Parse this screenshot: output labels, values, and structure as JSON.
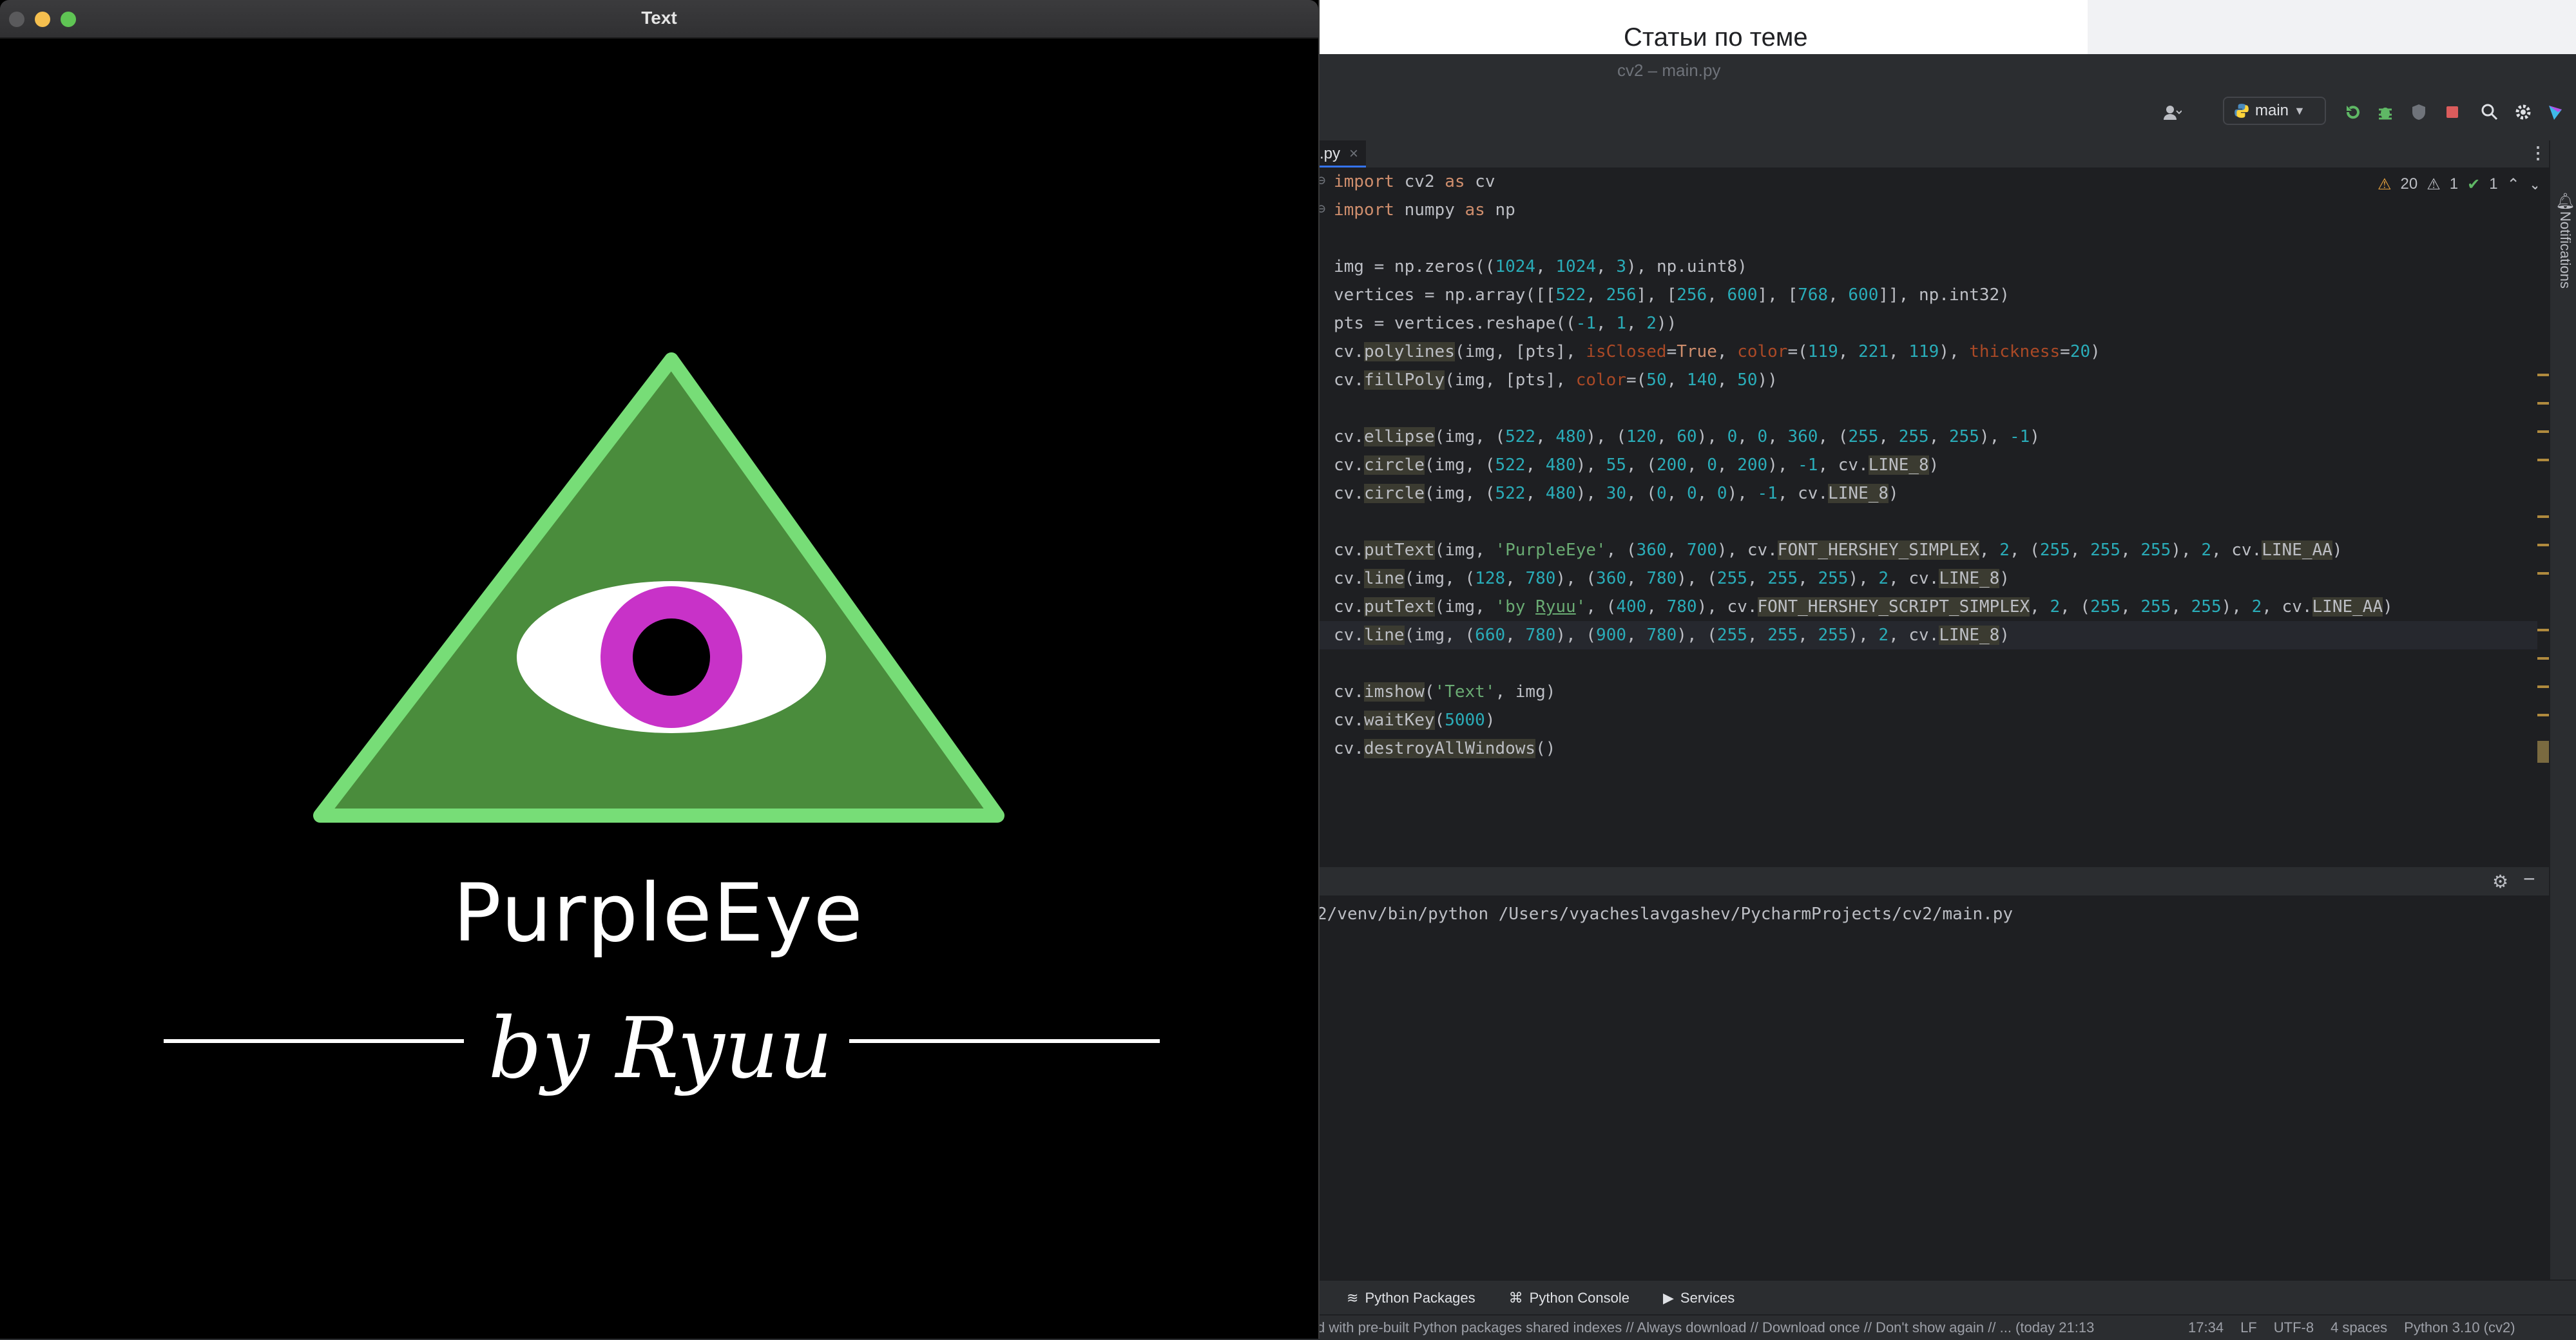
{
  "browser": {
    "page_title": "Статьи по теме"
  },
  "ide": {
    "window_title": "cv2 – main.py",
    "branch": "main",
    "tab": {
      "label": ".py",
      "close": "×"
    },
    "inspections": {
      "warnings": "20",
      "weak_warnings": "1",
      "ok": "1"
    },
    "notifications_label": "Notifications",
    "code": [
      "import cv2 as cv",
      "import numpy as np",
      "",
      "img = np.zeros((1024, 1024, 3), np.uint8)",
      "vertices = np.array([[522, 256], [256, 600], [768, 600]], np.int32)",
      "pts = vertices.reshape((-1, 1, 2))",
      "cv.polylines(img, [pts], isClosed=True, color=(119, 221, 119), thickness=20)",
      "cv.fillPoly(img, [pts], color=(50, 140, 50))",
      "",
      "cv.ellipse(img, (522, 480), (120, 60), 0, 0, 360, (255, 255, 255), -1)",
      "cv.circle(img, (522, 480), 55, (200, 0, 200), -1, cv.LINE_8)",
      "cv.circle(img, (522, 480), 30, (0, 0, 0), -1, cv.LINE_8)",
      "",
      "cv.putText(img, 'PurpleEye', (360, 700), cv.FONT_HERSHEY_SIMPLEX, 2, (255, 255, 255), 2, cv.LINE_AA)",
      "cv.line(img, (128, 780), (360, 780), (255, 255, 255), 2, cv.LINE_8)",
      "cv.putText(img, 'by Ryuu', (400, 780), cv.FONT_HERSHEY_SCRIPT_SIMPLEX, 2, (255, 255, 255), 2, cv.LINE_AA)",
      "cv.line(img, (660, 780), (900, 780), (255, 255, 255), 2, cv.LINE_8)",
      "",
      "cv.imshow('Text', img)",
      "cv.waitKey(5000)",
      "cv.destroyAllWindows()"
    ],
    "run_command": "2/venv/bin/python /Users/vyacheslavgashev/PycharmProjects/cv2/main.py",
    "bottom_tools": [
      "Python Packages",
      "Python Console",
      "Services"
    ],
    "status_message": "d with pre-built Python packages shared indexes // Always download // Download once // Don't show again // ... (today 21:13",
    "status_right": [
      "17:34",
      "LF",
      "UTF-8",
      "4 spaces",
      "Python 3.10 (cv2)"
    ]
  },
  "cv_window": {
    "title": "Text",
    "heading": "PurpleEye",
    "byline": "by Ryuu"
  },
  "colors": {
    "triangle_fill": "#4a8c3c",
    "triangle_border": "#77dd77",
    "iris": "#c832c8",
    "pupil": "#000000",
    "sclera": "#ffffff"
  }
}
